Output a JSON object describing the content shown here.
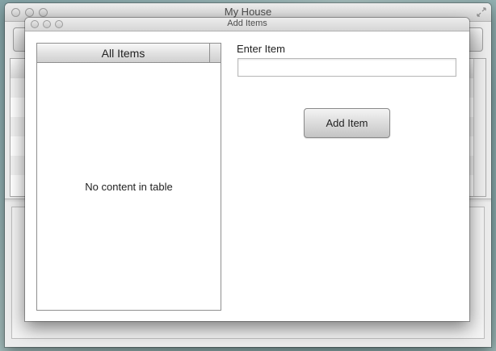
{
  "main_window": {
    "title": "My House"
  },
  "dialog": {
    "title": "Add Items",
    "table": {
      "column_header": "All Items",
      "empty_text": "No content in table"
    },
    "form": {
      "input_label": "Enter Item",
      "input_value": "",
      "input_placeholder": "",
      "add_button_label": "Add Item"
    }
  },
  "icons": {
    "traffic_lights": "window-control-buttons",
    "resize": "fullscreen-resize-icon"
  }
}
